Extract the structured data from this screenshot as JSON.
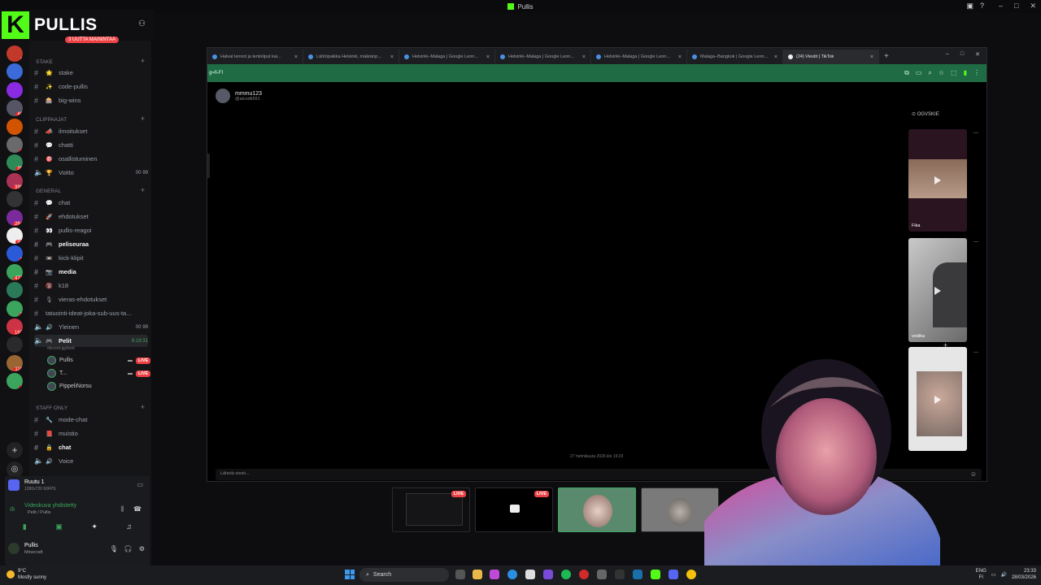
{
  "window": {
    "title": "Pullis"
  },
  "brand": {
    "name": "PULLIS",
    "letter": "K",
    "new_badge": "3 UUTTA MAININTAA"
  },
  "servers": [
    {
      "badge": "1"
    },
    {
      "badge": ""
    },
    {
      "badge": ""
    },
    {
      "badge": "46"
    },
    {
      "badge": ""
    },
    {
      "badge": "4"
    },
    {
      "badge": "35"
    },
    {
      "badge": "398"
    },
    {
      "badge": ""
    },
    {
      "badge": "264"
    },
    {
      "badge": "91"
    },
    {
      "badge": "1"
    },
    {
      "badge": "477"
    },
    {
      "badge": ""
    },
    {
      "badge": "2"
    },
    {
      "badge": "163"
    },
    {
      "badge": ""
    },
    {
      "badge": "116"
    },
    {
      "badge": "4"
    }
  ],
  "categories": {
    "stake": "Stake",
    "clippaajat": "CLIPPAAJAT",
    "general": "GENERAL",
    "staff": "STAFF ONLY"
  },
  "channels": {
    "stake": [
      {
        "name": "stake",
        "emoji": "🌟"
      },
      {
        "name": "code-pullis",
        "emoji": "✨"
      },
      {
        "name": "big-wins",
        "emoji": "🎰"
      }
    ],
    "clippaajat": [
      {
        "name": "ilmoitukset",
        "emoji": "📣"
      },
      {
        "name": "chatti",
        "emoji": "💬"
      },
      {
        "name": "osallistuminen",
        "emoji": "🎯"
      }
    ],
    "voitto": {
      "name": "Voitto",
      "emoji": "🏆",
      "count": "00",
      "limit": "99"
    },
    "general": [
      {
        "name": "chat",
        "emoji": "💬",
        "bold": false
      },
      {
        "name": "ehdotukset",
        "emoji": "🚀",
        "bold": false
      },
      {
        "name": "pullis-reagoi",
        "emoji": "👀",
        "bold": false
      },
      {
        "name": "peliseurаa",
        "emoji": "🎮",
        "bold": true
      },
      {
        "name": "kick-klipit",
        "emoji": "📼",
        "bold": false
      },
      {
        "name": "media",
        "emoji": "📷",
        "bold": true
      },
      {
        "name": "k18",
        "emoji": "🔞",
        "bold": false
      },
      {
        "name": "vieras-ehdotukset",
        "emoji": "🎙",
        "bold": false
      }
    ],
    "tatuointi": "tatuointi-ideat-joka-sub-uus-ta...",
    "yleinen": {
      "name": "Yleinen",
      "emoji": "🔊",
      "count": "00",
      "limit": "99"
    },
    "pelit": {
      "name": "Pelit",
      "emoji": "🎮",
      "sub": "discord.gg/kerk",
      "time": "6:19:31"
    },
    "voice_users": [
      {
        "name": "Pullis",
        "live": "LIVE"
      },
      {
        "name": "T...",
        "live": "LIVE"
      },
      {
        "name": "PippeliNorsu",
        "live": ""
      }
    ],
    "staff": [
      {
        "name": "mode-chat",
        "emoji": "🔧",
        "bold": false
      },
      {
        "name": "muistio",
        "emoji": "📕",
        "bold": false
      },
      {
        "name": "chat",
        "emoji": "🔒",
        "bold": true
      },
      {
        "name": "Voice",
        "emoji": "🔊",
        "bold": false
      }
    ]
  },
  "panel": {
    "stream_title": "Ruutu 1",
    "stream_sub": "1280x720 60FPS",
    "voice_status": "Videokuva yhdistetty",
    "voice_channel": "Pelit / Pullis",
    "user_name": "Pullis",
    "user_status": "Minecraft"
  },
  "browser": {
    "tabs": [
      {
        "label": "Halvat lennot ja lentoliput kai...",
        "active": false
      },
      {
        "label": "Lähtöpaikka Helsinki, määränp...",
        "active": false
      },
      {
        "label": "Helsinki–Malaga | Google Lenn...",
        "active": false
      },
      {
        "label": "Helsinki–Malaga | Google Lenn...",
        "active": false
      },
      {
        "label": "Helsinki–Malaga | Google Lenn...",
        "active": false
      },
      {
        "label": "Malaga–Bangkok | Google Lenn...",
        "active": false
      },
      {
        "label": "(24) Viestit | TikTok",
        "active": true
      }
    ],
    "url": "g=fi-FI",
    "profile_name": "mmmu123",
    "profile_handle": "@aicodk591",
    "timestamp": "27 helmikuuta 2026 klo 19:23",
    "message_placeholder": "Lähetä viesti...",
    "side_label": "OGVSKIE",
    "videos": [
      {
        "caption": "Fika"
      },
      {
        "caption": "vedika"
      },
      {
        "caption": ""
      }
    ]
  },
  "thumbnails": [
    {
      "live": "LIVE"
    },
    {
      "live": "LIVE"
    },
    {
      "live": ""
    },
    {
      "live": ""
    }
  ],
  "taskbar": {
    "temp": "9°C",
    "weather": "Mostly sunny",
    "search": "Search",
    "lang": "ENG",
    "region": "FI",
    "time": "23:33",
    "date": "28/03/2026"
  },
  "colors": {
    "kick_green": "#53fc18",
    "live_red": "#ed4245",
    "address_bar": "#1f6b44"
  }
}
